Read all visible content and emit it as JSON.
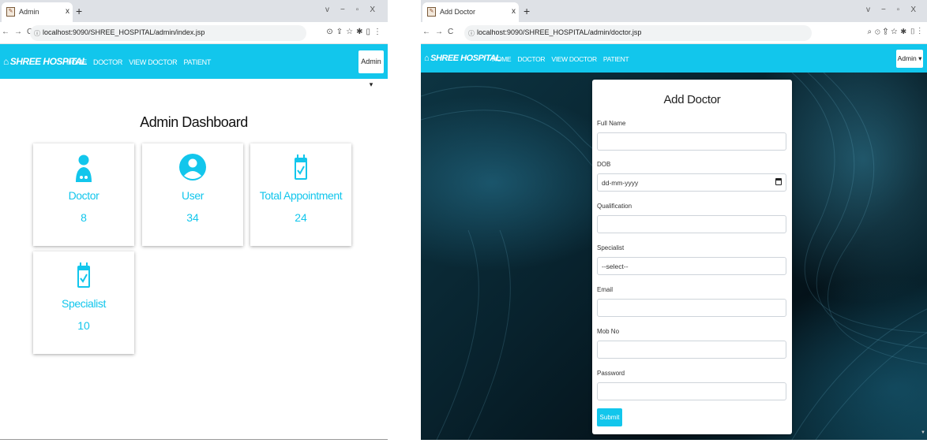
{
  "left_window": {
    "tab_title": "Admin",
    "url": "localhost:9090/SHREE_HOSPITAL/admin/index.jsp",
    "navbar": {
      "brand": "SHREE HOSPITAL",
      "links": [
        "HOME",
        "DOCTOR",
        "VIEW DOCTOR",
        "PATIENT"
      ],
      "admin_button": "Admin ▾"
    },
    "dashboard": {
      "title": "Admin Dashboard",
      "cards": [
        {
          "label": "Doctor",
          "value": "8",
          "icon": "doctor-icon"
        },
        {
          "label": "User",
          "value": "34",
          "icon": "user-icon"
        },
        {
          "label": "Total Appointment",
          "value": "24",
          "icon": "calendar-check-icon"
        },
        {
          "label": "Specialist",
          "value": "10",
          "icon": "calendar-check-icon"
        }
      ]
    }
  },
  "right_window": {
    "tab_title": "Add Doctor",
    "url": "localhost:9090/SHREE_HOSPITAL/admin/doctor.jsp",
    "navbar": {
      "brand": "SHREE HOSPITAL",
      "links": [
        "HOME",
        "DOCTOR",
        "VIEW DOCTOR",
        "PATIENT"
      ],
      "admin_button": "Admin ▾"
    },
    "form": {
      "title": "Add Doctor",
      "fields": [
        {
          "label": "Full Name",
          "value": ""
        },
        {
          "label": "DOB",
          "value": "dd-mm-yyyy"
        },
        {
          "label": "Qualification",
          "value": ""
        },
        {
          "label": "Specialist",
          "value": "--select--"
        },
        {
          "label": "Email",
          "value": ""
        },
        {
          "label": "Mob No",
          "value": ""
        },
        {
          "label": "Password",
          "value": ""
        }
      ],
      "submit_label": "Submit"
    }
  },
  "colors": {
    "accent": "#12c6ec",
    "background_dark": "#08222d"
  }
}
